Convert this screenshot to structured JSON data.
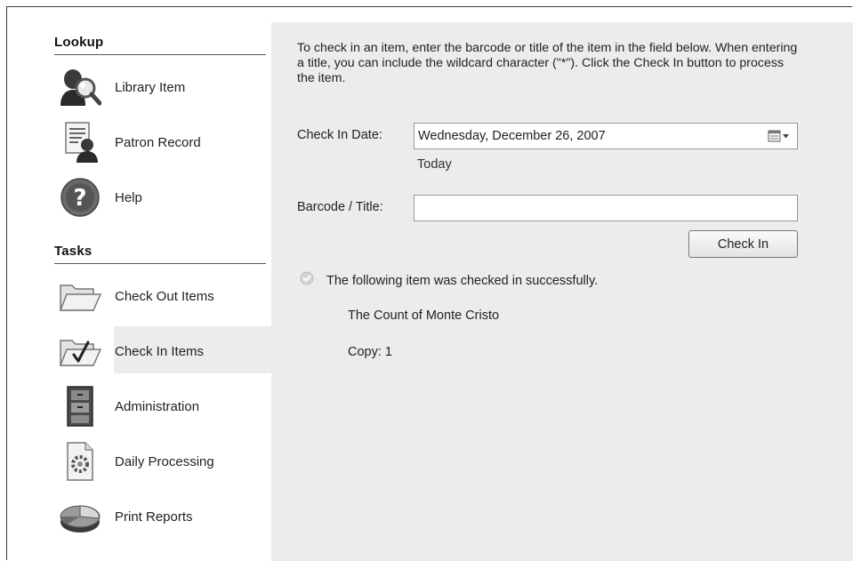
{
  "sidebar": {
    "lookup_title": "Lookup",
    "lookup_items": [
      {
        "label": "Library Item",
        "icon": "library-item-search-icon"
      },
      {
        "label": "Patron Record",
        "icon": "patron-record-icon"
      },
      {
        "label": "Help",
        "icon": "help-icon"
      }
    ],
    "tasks_title": "Tasks",
    "task_items": [
      {
        "label": "Check Out Items",
        "icon": "open-folder-icon"
      },
      {
        "label": "Check In Items",
        "icon": "folder-checkmark-icon",
        "selected": true
      },
      {
        "label": "Administration",
        "icon": "file-cabinet-icon"
      },
      {
        "label": "Daily Processing",
        "icon": "gear-document-icon"
      },
      {
        "label": "Print Reports",
        "icon": "pie-chart-icon"
      }
    ]
  },
  "main": {
    "intro_text": "To check in an item, enter the barcode or title of the item in the field below. When entering a title, you can include the wildcard character (\"*\"). Click the Check In button to process the item.",
    "check_in_date_label": "Check In Date:",
    "check_in_date_value": "Wednesday, December 26, 2007",
    "today_label": "Today",
    "barcode_label": "Barcode / Title:",
    "barcode_value": "",
    "check_in_button": "Check In",
    "status_message": "The following item was checked in successfully.",
    "item_title": "The Count of Monte Cristo",
    "item_copy": "Copy: 1"
  },
  "colors": {
    "panel_bg": "#ececec",
    "selected_bg": "#ececec"
  }
}
